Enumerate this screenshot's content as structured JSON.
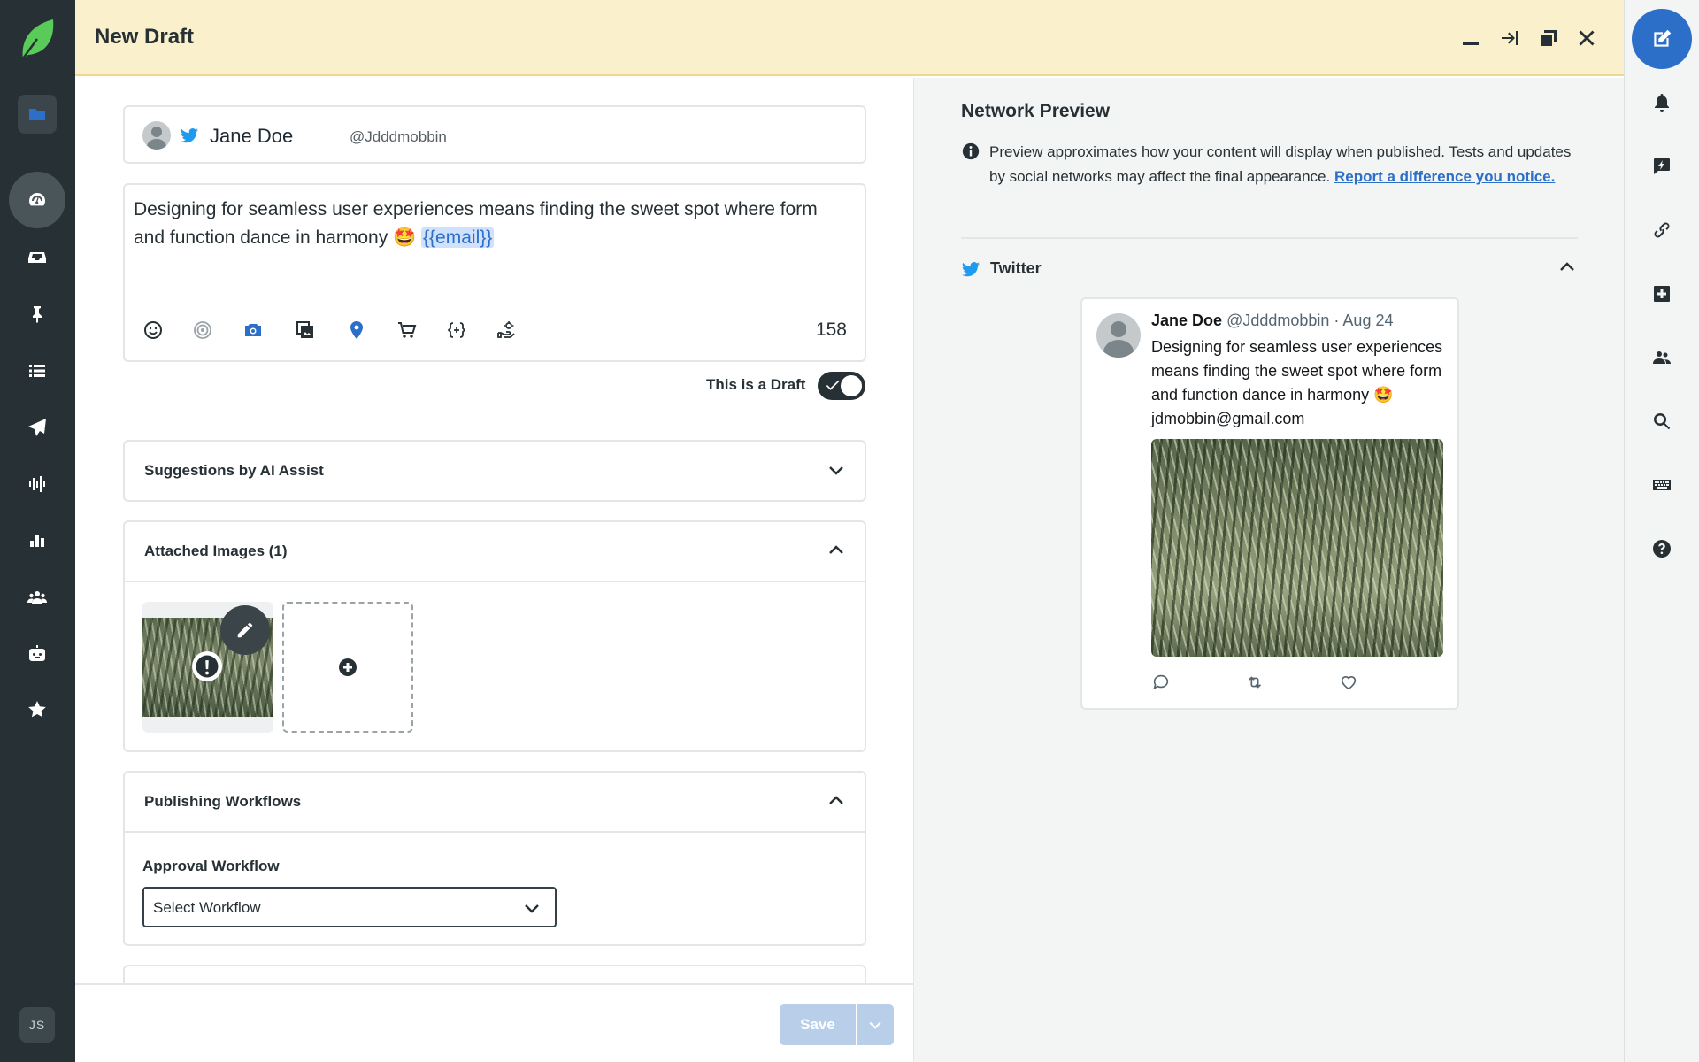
{
  "header": {
    "title": "New Draft"
  },
  "left_rail": {
    "avatar_initials": "JS",
    "items": [
      "folder-icon",
      "dashboard-icon",
      "inbox-icon",
      "pin-icon",
      "list-icon",
      "send-icon",
      "listening-icon",
      "reports-icon",
      "people-icon",
      "bot-icon",
      "star-icon"
    ]
  },
  "right_rail": {
    "items": [
      "compose-icon",
      "bell-icon",
      "feedback-icon",
      "link-icon",
      "plus-icon",
      "team-icon",
      "search-icon",
      "keyboard-icon",
      "help-icon"
    ]
  },
  "composer": {
    "profile": {
      "name": "Jane Doe",
      "handle": "@Jdddmobbin"
    },
    "text": "Designing for seamless user experiences means finding the sweet spot where form and function dance in harmony 🤩",
    "token": "{{email}}",
    "char_count": "158",
    "draft_label": "This is a Draft",
    "draft_enabled": true
  },
  "sections": {
    "ai_assist": "Suggestions by AI Assist",
    "attached_images": "Attached Images (1)",
    "publishing_workflows": "Publishing Workflows",
    "approval_label": "Approval Workflow",
    "workflow_select": "Select Workflow"
  },
  "footer": {
    "save_label": "Save"
  },
  "preview": {
    "title": "Network Preview",
    "note": "Preview approximates how your content will display when published. Tests and updates by social networks may affect the final appearance.",
    "note_link": "Report a difference you notice.",
    "network": "Twitter",
    "tweet": {
      "name": "Jane Doe",
      "handle": "@Jdddmobbin",
      "date": "· Aug 24",
      "body": "Designing for seamless user experiences means finding the sweet spot where form and function dance in harmony 🤩 jdmobbin@gmail.com"
    }
  },
  "colors": {
    "sidebar": "#273135",
    "header": "#fbf0cc",
    "accent": "#2b6fc9",
    "twitter": "#1d9bf0",
    "save_disabled": "#b9cfe9"
  }
}
